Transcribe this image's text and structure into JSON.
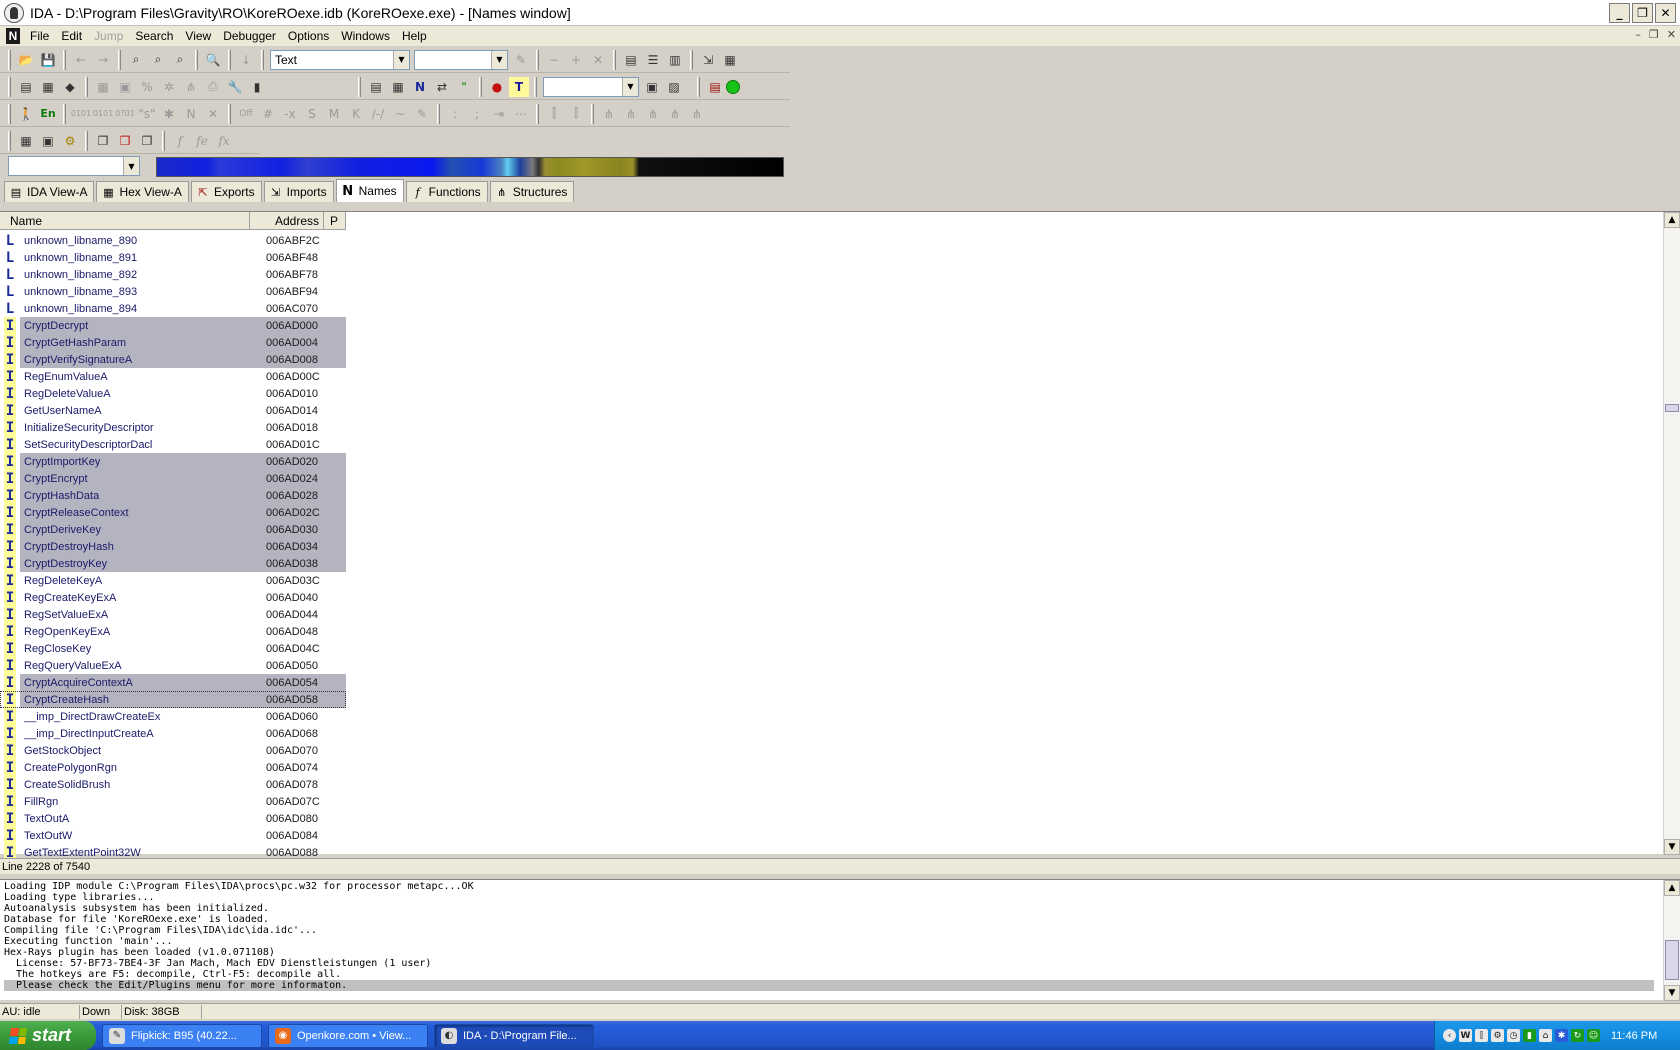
{
  "window": {
    "title": "IDA - D:\\Program Files\\Gravity\\RO\\KoreROexe.idb (KoreROexe.exe) - [Names window]"
  },
  "menu": {
    "items": [
      "File",
      "Edit",
      "Jump",
      "Search",
      "View",
      "Debugger",
      "Options",
      "Windows",
      "Help"
    ]
  },
  "toolbar": {
    "text_mode_value": "Text",
    "second_select_value": "",
    "third_select_value": ""
  },
  "navband": {
    "segment_select_value": ""
  },
  "tabs": [
    {
      "label": "IDA View-A",
      "icon": "document-icon"
    },
    {
      "label": "Hex View-A",
      "icon": "hex-icon"
    },
    {
      "label": "Exports",
      "icon": "export-icon"
    },
    {
      "label": "Imports",
      "icon": "import-icon"
    },
    {
      "label": "Names",
      "icon": "n-icon"
    },
    {
      "label": "Functions",
      "icon": "function-icon"
    },
    {
      "label": "Structures",
      "icon": "structure-icon"
    }
  ],
  "names_table": {
    "headers": {
      "name": "Name",
      "address": "Address",
      "p": "P"
    },
    "rows": [
      {
        "kind": "L",
        "name": "unknown_libname_890",
        "address": "006ABF2C",
        "selected": false
      },
      {
        "kind": "L",
        "name": "unknown_libname_891",
        "address": "006ABF48",
        "selected": false
      },
      {
        "kind": "L",
        "name": "unknown_libname_892",
        "address": "006ABF78",
        "selected": false
      },
      {
        "kind": "L",
        "name": "unknown_libname_893",
        "address": "006ABF94",
        "selected": false
      },
      {
        "kind": "L",
        "name": "unknown_libname_894",
        "address": "006AC070",
        "selected": false
      },
      {
        "kind": "I",
        "name": "CryptDecrypt",
        "address": "006AD000",
        "selected": true
      },
      {
        "kind": "I",
        "name": "CryptGetHashParam",
        "address": "006AD004",
        "selected": true
      },
      {
        "kind": "I",
        "name": "CryptVerifySignatureA",
        "address": "006AD008",
        "selected": true
      },
      {
        "kind": "I",
        "name": "RegEnumValueA",
        "address": "006AD00C",
        "selected": false
      },
      {
        "kind": "I",
        "name": "RegDeleteValueA",
        "address": "006AD010",
        "selected": false
      },
      {
        "kind": "I",
        "name": "GetUserNameA",
        "address": "006AD014",
        "selected": false
      },
      {
        "kind": "I",
        "name": "InitializeSecurityDescriptor",
        "address": "006AD018",
        "selected": false
      },
      {
        "kind": "I",
        "name": "SetSecurityDescriptorDacl",
        "address": "006AD01C",
        "selected": false
      },
      {
        "kind": "I",
        "name": "CryptImportKey",
        "address": "006AD020",
        "selected": true
      },
      {
        "kind": "I",
        "name": "CryptEncrypt",
        "address": "006AD024",
        "selected": true
      },
      {
        "kind": "I",
        "name": "CryptHashData",
        "address": "006AD028",
        "selected": true
      },
      {
        "kind": "I",
        "name": "CryptReleaseContext",
        "address": "006AD02C",
        "selected": true
      },
      {
        "kind": "I",
        "name": "CryptDeriveKey",
        "address": "006AD030",
        "selected": true
      },
      {
        "kind": "I",
        "name": "CryptDestroyHash",
        "address": "006AD034",
        "selected": true
      },
      {
        "kind": "I",
        "name": "CryptDestroyKey",
        "address": "006AD038",
        "selected": true
      },
      {
        "kind": "I",
        "name": "RegDeleteKeyA",
        "address": "006AD03C",
        "selected": false
      },
      {
        "kind": "I",
        "name": "RegCreateKeyExA",
        "address": "006AD040",
        "selected": false
      },
      {
        "kind": "I",
        "name": "RegSetValueExA",
        "address": "006AD044",
        "selected": false
      },
      {
        "kind": "I",
        "name": "RegOpenKeyExA",
        "address": "006AD048",
        "selected": false
      },
      {
        "kind": "I",
        "name": "RegCloseKey",
        "address": "006AD04C",
        "selected": false
      },
      {
        "kind": "I",
        "name": "RegQueryValueExA",
        "address": "006AD050",
        "selected": false
      },
      {
        "kind": "I",
        "name": "CryptAcquireContextA",
        "address": "006AD054",
        "selected": true
      },
      {
        "kind": "I",
        "name": "CryptCreateHash",
        "address": "006AD058",
        "selected": true,
        "focused": true
      },
      {
        "kind": "I",
        "name": "__imp_DirectDrawCreateEx",
        "address": "006AD060",
        "selected": false
      },
      {
        "kind": "I",
        "name": "__imp_DirectInputCreateA",
        "address": "006AD068",
        "selected": false
      },
      {
        "kind": "I",
        "name": "GetStockObject",
        "address": "006AD070",
        "selected": false
      },
      {
        "kind": "I",
        "name": "CreatePolygonRgn",
        "address": "006AD074",
        "selected": false
      },
      {
        "kind": "I",
        "name": "CreateSolidBrush",
        "address": "006AD078",
        "selected": false
      },
      {
        "kind": "I",
        "name": "FillRgn",
        "address": "006AD07C",
        "selected": false
      },
      {
        "kind": "I",
        "name": "TextOutA",
        "address": "006AD080",
        "selected": false
      },
      {
        "kind": "I",
        "name": "TextOutW",
        "address": "006AD084",
        "selected": false
      },
      {
        "kind": "I",
        "name": "GetTextExtentPoint32W",
        "address": "006AD088",
        "selected": false
      }
    ]
  },
  "line_status": "Line 2228 of 7540",
  "output": {
    "lines": [
      "Loading IDP module C:\\Program Files\\IDA\\procs\\pc.w32 for processor metapc...OK",
      "Loading type libraries...",
      "Autoanalysis subsystem has been initialized.",
      "Database for file 'KoreROexe.exe' is loaded.",
      "Compiling file 'C:\\Program Files\\IDA\\idc\\ida.idc'...",
      "Executing function 'main'...",
      "Hex-Rays plugin has been loaded (v1.0.071108)",
      "  License: 57-BF73-7BE4-3F Jan Mach, Mach EDV Dienstleistungen (1 user)",
      "  The hotkeys are F5: decompile, Ctrl-F5: decompile all.",
      "  Please check the Edit/Plugins menu for more informaton."
    ]
  },
  "status_bar": {
    "au": "AU:  idle",
    "direction": "Down",
    "disk": "Disk: 38GB"
  },
  "taskbar": {
    "start_label": "start",
    "tasks": [
      {
        "label": "Flipkick: B95 (40.22...",
        "icon": "flipkick-icon",
        "active": false
      },
      {
        "label": "Openkore.com • View...",
        "icon": "firefox-icon",
        "active": false
      },
      {
        "label": "IDA - D:\\Program File...",
        "icon": "ida-icon",
        "active": true
      }
    ],
    "clock": "11:46 PM"
  }
}
